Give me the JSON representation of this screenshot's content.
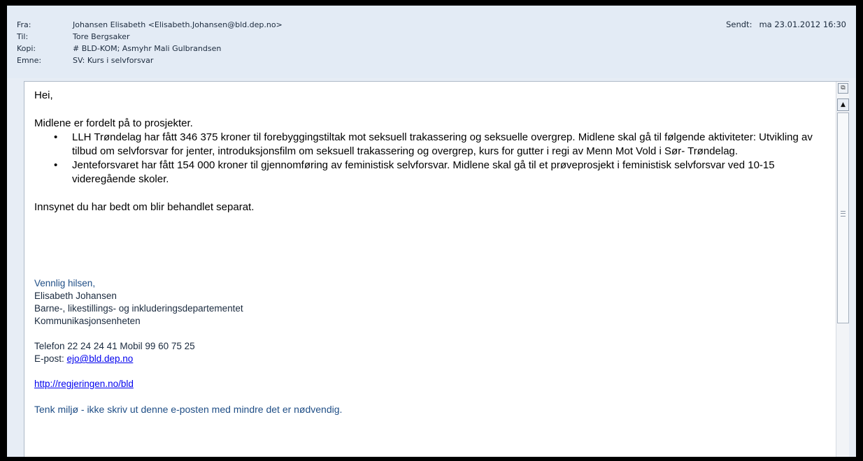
{
  "header": {
    "from_label": "Fra:",
    "from_value": "Johansen Elisabeth <Elisabeth.Johansen@bld.dep.no>",
    "to_label": "Til:",
    "to_value": "Tore Bergsaker",
    "cc_label": "Kopi:",
    "cc_value": "# BLD-KOM; Asmyhr Mali Gulbrandsen",
    "subject_label": "Emne:",
    "subject_value": "SV: Kurs i selvforsvar",
    "sent_label": "Sendt:",
    "sent_value": "ma 23.01.2012 16:30"
  },
  "body": {
    "greeting": "Hei,",
    "intro": "Midlene er fordelt på to prosjekter.",
    "bullet_char": "•",
    "bullets": [
      "LLH Trøndelag har fått 346 375 kroner til forebyggingstiltak mot seksuell trakassering og seksuelle overgrep. Midlene skal gå til følgende aktiviteter: Utvikling av tilbud om selvforsvar for jenter, introduksjonsfilm om seksuell trakassering og overgrep, kurs for gutter i regi av Menn Mot Vold i Sør- Trøndelag.",
      "Jenteforsvaret har fått 154 000 kroner til gjennomføring av feministisk selvforsvar. Midlene skal gå til et prøveprosjekt i feministisk selvforsvar ved 10-15 videregående skoler."
    ],
    "closing": "Innsynet du har bedt om blir behandlet separat."
  },
  "signature": {
    "greeting": "Vennlig hilsen,",
    "name": "Elisabeth Johansen",
    "department": "Barne-, likestillings- og inkluderingsdepartementet",
    "unit": "Kommunikasjonsenheten",
    "phone": "Telefon 22 24 24 41 Mobil 99 60 75 25",
    "email_prefix": "E-post: ",
    "email": "ejo@bld.dep.no",
    "website": "http://regjeringen.no/bld",
    "footer": "Tenk miljø - ikke skriv ut denne e-posten med mindre det er nødvendig."
  }
}
